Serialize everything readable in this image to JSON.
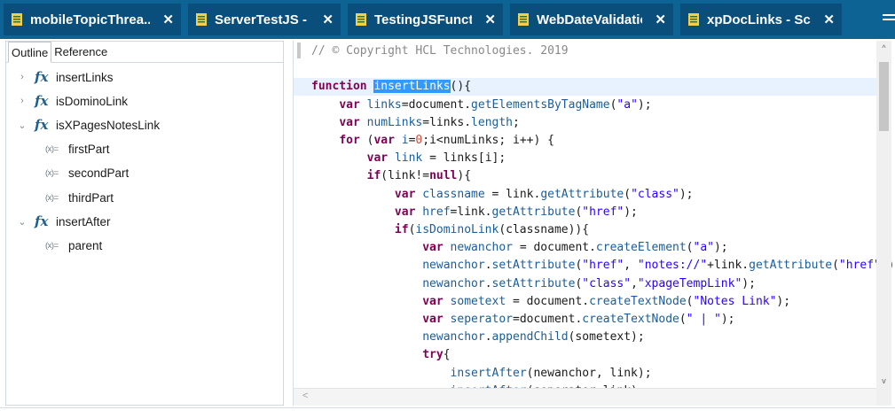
{
  "tabs": [
    {
      "label": "mobileTopicThrea...",
      "close": "✕"
    },
    {
      "label": "ServerTestJS - Sc...",
      "close": "✕"
    },
    {
      "label": "TestingJSFuncti...",
      "close": "✕"
    },
    {
      "label": "WebDateValidatio...",
      "close": "✕"
    },
    {
      "label": "xpDocLinks - Scri...",
      "close": "✕"
    }
  ],
  "colors": {
    "tabbar": "#0d6394",
    "tab": "#0a4f7c",
    "selection": "#3399ff",
    "keyword": "#7f0055",
    "identifier": "#1a5d9a",
    "string": "#2a00ff"
  },
  "panel": {
    "tabs": [
      "Outline",
      "Reference"
    ],
    "tree": [
      {
        "label": "insertLinks",
        "type": "function",
        "twisty": "›"
      },
      {
        "label": "isDominoLink",
        "type": "function",
        "twisty": "›"
      },
      {
        "label": "isXPagesNotesLink",
        "type": "function",
        "twisty": "⌄"
      },
      {
        "label": "firstPart",
        "type": "variable",
        "twisty": ""
      },
      {
        "label": "secondPart",
        "type": "variable",
        "twisty": ""
      },
      {
        "label": "thirdPart",
        "type": "variable",
        "twisty": ""
      },
      {
        "label": "insertAfter",
        "type": "function",
        "twisty": "⌄"
      },
      {
        "label": "parent",
        "type": "variable",
        "twisty": ""
      }
    ],
    "icons": {
      "function": "fx",
      "variable": "(x)="
    }
  },
  "editor": {
    "lines": [
      [
        [
          "cm",
          "// © Copyright HCL Technologies. 2019"
        ]
      ],
      [
        [
          "tx",
          ""
        ]
      ],
      [
        [
          "kw",
          "function "
        ],
        [
          "sel",
          "insertLinks"
        ],
        [
          "tx",
          "(){"
        ]
      ],
      [
        [
          "tx",
          "    "
        ],
        [
          "kw",
          "var "
        ],
        [
          "id",
          "links"
        ],
        [
          "tx",
          "=document."
        ],
        [
          "id",
          "getElementsByTagName"
        ],
        [
          "tx",
          "("
        ],
        [
          "st",
          "\"a\""
        ],
        [
          "tx",
          ");"
        ]
      ],
      [
        [
          "tx",
          "    "
        ],
        [
          "kw",
          "var "
        ],
        [
          "id",
          "numLinks"
        ],
        [
          "tx",
          "=links."
        ],
        [
          "id",
          "length"
        ],
        [
          "tx",
          ";"
        ]
      ],
      [
        [
          "tx",
          "    "
        ],
        [
          "kw",
          "for "
        ],
        [
          "tx",
          "("
        ],
        [
          "kw",
          "var "
        ],
        [
          "id",
          "i"
        ],
        [
          "tx",
          "="
        ],
        [
          "nm",
          "0"
        ],
        [
          "tx",
          ";i<numLinks; i++) {"
        ]
      ],
      [
        [
          "tx",
          "        "
        ],
        [
          "kw",
          "var "
        ],
        [
          "id",
          "link"
        ],
        [
          "tx",
          " = links[i];"
        ]
      ],
      [
        [
          "tx",
          "        "
        ],
        [
          "kw",
          "if"
        ],
        [
          "tx",
          "(link!="
        ],
        [
          "kw",
          "null"
        ],
        [
          "tx",
          "){"
        ]
      ],
      [
        [
          "tx",
          "            "
        ],
        [
          "kw",
          "var "
        ],
        [
          "id",
          "classname"
        ],
        [
          "tx",
          " = link."
        ],
        [
          "id",
          "getAttribute"
        ],
        [
          "tx",
          "("
        ],
        [
          "st",
          "\"class\""
        ],
        [
          "tx",
          ");"
        ]
      ],
      [
        [
          "tx",
          "            "
        ],
        [
          "kw",
          "var "
        ],
        [
          "id",
          "href"
        ],
        [
          "tx",
          "=link."
        ],
        [
          "id",
          "getAttribute"
        ],
        [
          "tx",
          "("
        ],
        [
          "st",
          "\"href\""
        ],
        [
          "tx",
          ");"
        ]
      ],
      [
        [
          "tx",
          "            "
        ],
        [
          "kw",
          "if"
        ],
        [
          "tx",
          "("
        ],
        [
          "id",
          "isDominoLink"
        ],
        [
          "tx",
          "(classname)){"
        ]
      ],
      [
        [
          "tx",
          "                "
        ],
        [
          "kw",
          "var "
        ],
        [
          "id",
          "newanchor"
        ],
        [
          "tx",
          " = document."
        ],
        [
          "id",
          "createElement"
        ],
        [
          "tx",
          "("
        ],
        [
          "st",
          "\"a\""
        ],
        [
          "tx",
          ");"
        ]
      ],
      [
        [
          "tx",
          "                "
        ],
        [
          "id",
          "newanchor"
        ],
        [
          "tx",
          "."
        ],
        [
          "id",
          "setAttribute"
        ],
        [
          "tx",
          "("
        ],
        [
          "st",
          "\"href\""
        ],
        [
          "tx",
          ", "
        ],
        [
          "st",
          "\"notes://\""
        ],
        [
          "tx",
          "+link."
        ],
        [
          "id",
          "getAttribute"
        ],
        [
          "tx",
          "("
        ],
        [
          "st",
          "\"href\""
        ],
        [
          "tx",
          "));"
        ]
      ],
      [
        [
          "tx",
          "                "
        ],
        [
          "id",
          "newanchor"
        ],
        [
          "tx",
          "."
        ],
        [
          "id",
          "setAttribute"
        ],
        [
          "tx",
          "("
        ],
        [
          "st",
          "\"class\""
        ],
        [
          "tx",
          ","
        ],
        [
          "st",
          "\"xpageTempLink\""
        ],
        [
          "tx",
          ");"
        ]
      ],
      [
        [
          "tx",
          "                "
        ],
        [
          "kw",
          "var "
        ],
        [
          "id",
          "sometext"
        ],
        [
          "tx",
          " = document."
        ],
        [
          "id",
          "createTextNode"
        ],
        [
          "tx",
          "("
        ],
        [
          "st",
          "\"Notes Link\""
        ],
        [
          "tx",
          ");"
        ]
      ],
      [
        [
          "tx",
          "                "
        ],
        [
          "kw",
          "var "
        ],
        [
          "id",
          "seperator"
        ],
        [
          "tx",
          "=document."
        ],
        [
          "id",
          "createTextNode"
        ],
        [
          "tx",
          "("
        ],
        [
          "st",
          "\" | \""
        ],
        [
          "tx",
          ");"
        ]
      ],
      [
        [
          "tx",
          "                "
        ],
        [
          "id",
          "newanchor"
        ],
        [
          "tx",
          "."
        ],
        [
          "id",
          "appendChild"
        ],
        [
          "tx",
          "(sometext);"
        ]
      ],
      [
        [
          "tx",
          "                "
        ],
        [
          "kw",
          "try"
        ],
        [
          "tx",
          "{"
        ]
      ],
      [
        [
          "tx",
          "                    "
        ],
        [
          "id",
          "insertAfter"
        ],
        [
          "tx",
          "(newanchor, link);"
        ]
      ],
      [
        [
          "tx",
          "                    "
        ],
        [
          "id",
          "insertAfter"
        ],
        [
          "tx",
          "(seperator,link);"
        ]
      ]
    ],
    "current_line": 3,
    "scroll": {
      "up": "^",
      "down": "v",
      "left": "<"
    }
  }
}
